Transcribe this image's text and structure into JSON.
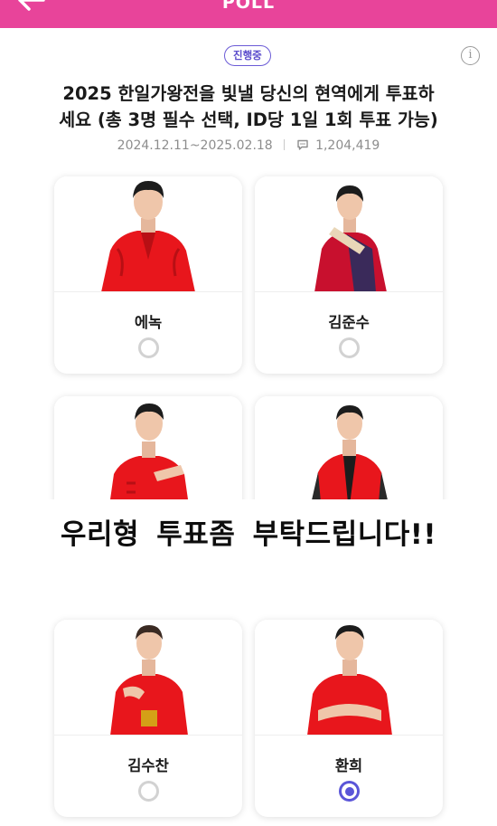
{
  "header": {
    "title": "POLL",
    "color": "#e8449a"
  },
  "poll": {
    "status": "진행중",
    "title_line1": "2025 한일가왕전을 빛낼 당신의 현역에게 투표하",
    "title_line2": "세요 (총 3명 필수 선택, ID당 1일 1회 투표 가능)",
    "date_range": "2024.12.11~2025.02.18",
    "comment_count": "1,204,419"
  },
  "candidates": [
    {
      "name": "에녹",
      "selected": false
    },
    {
      "name": "김준수",
      "selected": false
    },
    {
      "name": "",
      "selected": false
    },
    {
      "name": "",
      "selected": false
    },
    {
      "name": "김수찬",
      "selected": false
    },
    {
      "name": "환희",
      "selected": true
    }
  ],
  "overlay": {
    "text": "우리형 투표좀 부탁드립니다!!"
  },
  "colors": {
    "accent": "#5a55d8",
    "costume_red": "#e8161c",
    "muted_text": "#8d8d8d"
  },
  "icons": {
    "back": "arrow-left-icon",
    "info": "info-icon",
    "comment": "comment-icon",
    "radio": "radio-icon"
  }
}
